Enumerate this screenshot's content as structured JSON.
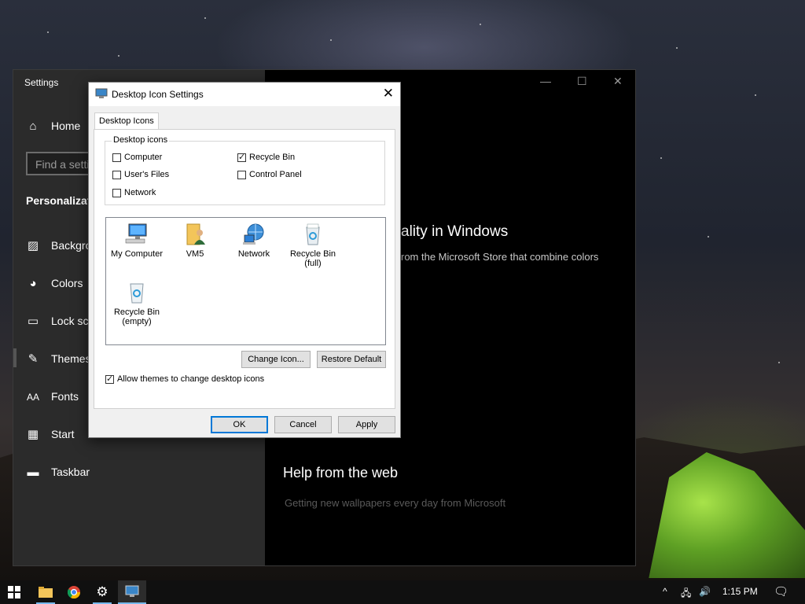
{
  "settings": {
    "title": "Settings",
    "nav": [
      {
        "label": "Home",
        "icon": "home-icon"
      },
      {
        "label": "Backgro",
        "icon": "image-icon"
      },
      {
        "label": "Colors",
        "icon": "palette-icon"
      },
      {
        "label": "Lock scr",
        "icon": "lock-screen-icon"
      },
      {
        "label": "Themes",
        "icon": "themes-icon"
      },
      {
        "label": "Fonts",
        "icon": "fonts-icon"
      },
      {
        "label": "Start",
        "icon": "start-icon"
      },
      {
        "label": "Taskbar",
        "icon": "taskbar-icon"
      }
    ],
    "search_placeholder": "Find a setti",
    "section_title": "Personalizati",
    "main_heading": "ality in Windows",
    "main_text": "rom the Microsoft Store that combine colors",
    "help_heading": "Help from the web",
    "help_text": "Getting new wallpapers every day from Microsoft",
    "window_controls": {
      "minimize": "—",
      "maximize": "☐",
      "close": "✕"
    }
  },
  "dialog": {
    "title": "Desktop Icon Settings",
    "close": "✕",
    "tab": "Desktop Icons",
    "group_title": "Desktop icons",
    "checkboxes": [
      {
        "label": "Computer",
        "checked": false
      },
      {
        "label": "User's Files",
        "checked": false
      },
      {
        "label": "Network",
        "checked": false
      },
      {
        "label": "Recycle Bin",
        "checked": true
      },
      {
        "label": "Control Panel",
        "checked": false
      }
    ],
    "icons": [
      {
        "label": "My Computer",
        "icon": "computer-icon"
      },
      {
        "label": "VM5",
        "icon": "user-folder-icon"
      },
      {
        "label": "Network",
        "icon": "network-icon"
      },
      {
        "label": "Recycle Bin\n(full)",
        "label_1": "Recycle Bin",
        "label_2": "(full)",
        "icon": "recycle-bin-full-icon"
      },
      {
        "label_1": "Recycle Bin",
        "label_2": "(empty)",
        "icon": "recycle-bin-empty-icon"
      }
    ],
    "change_icon": "Change Icon...",
    "restore_default": "Restore Default",
    "allow_themes": "Allow themes to change desktop icons",
    "allow_themes_checked": true,
    "ok": "OK",
    "cancel": "Cancel",
    "apply": "Apply"
  },
  "taskbar": {
    "apps": [
      "start-icon",
      "file-explorer-icon",
      "chrome-icon",
      "settings-gear-icon",
      "desktop-icon-settings-icon"
    ],
    "time": "1:15 PM",
    "tray_chevron": "^"
  }
}
